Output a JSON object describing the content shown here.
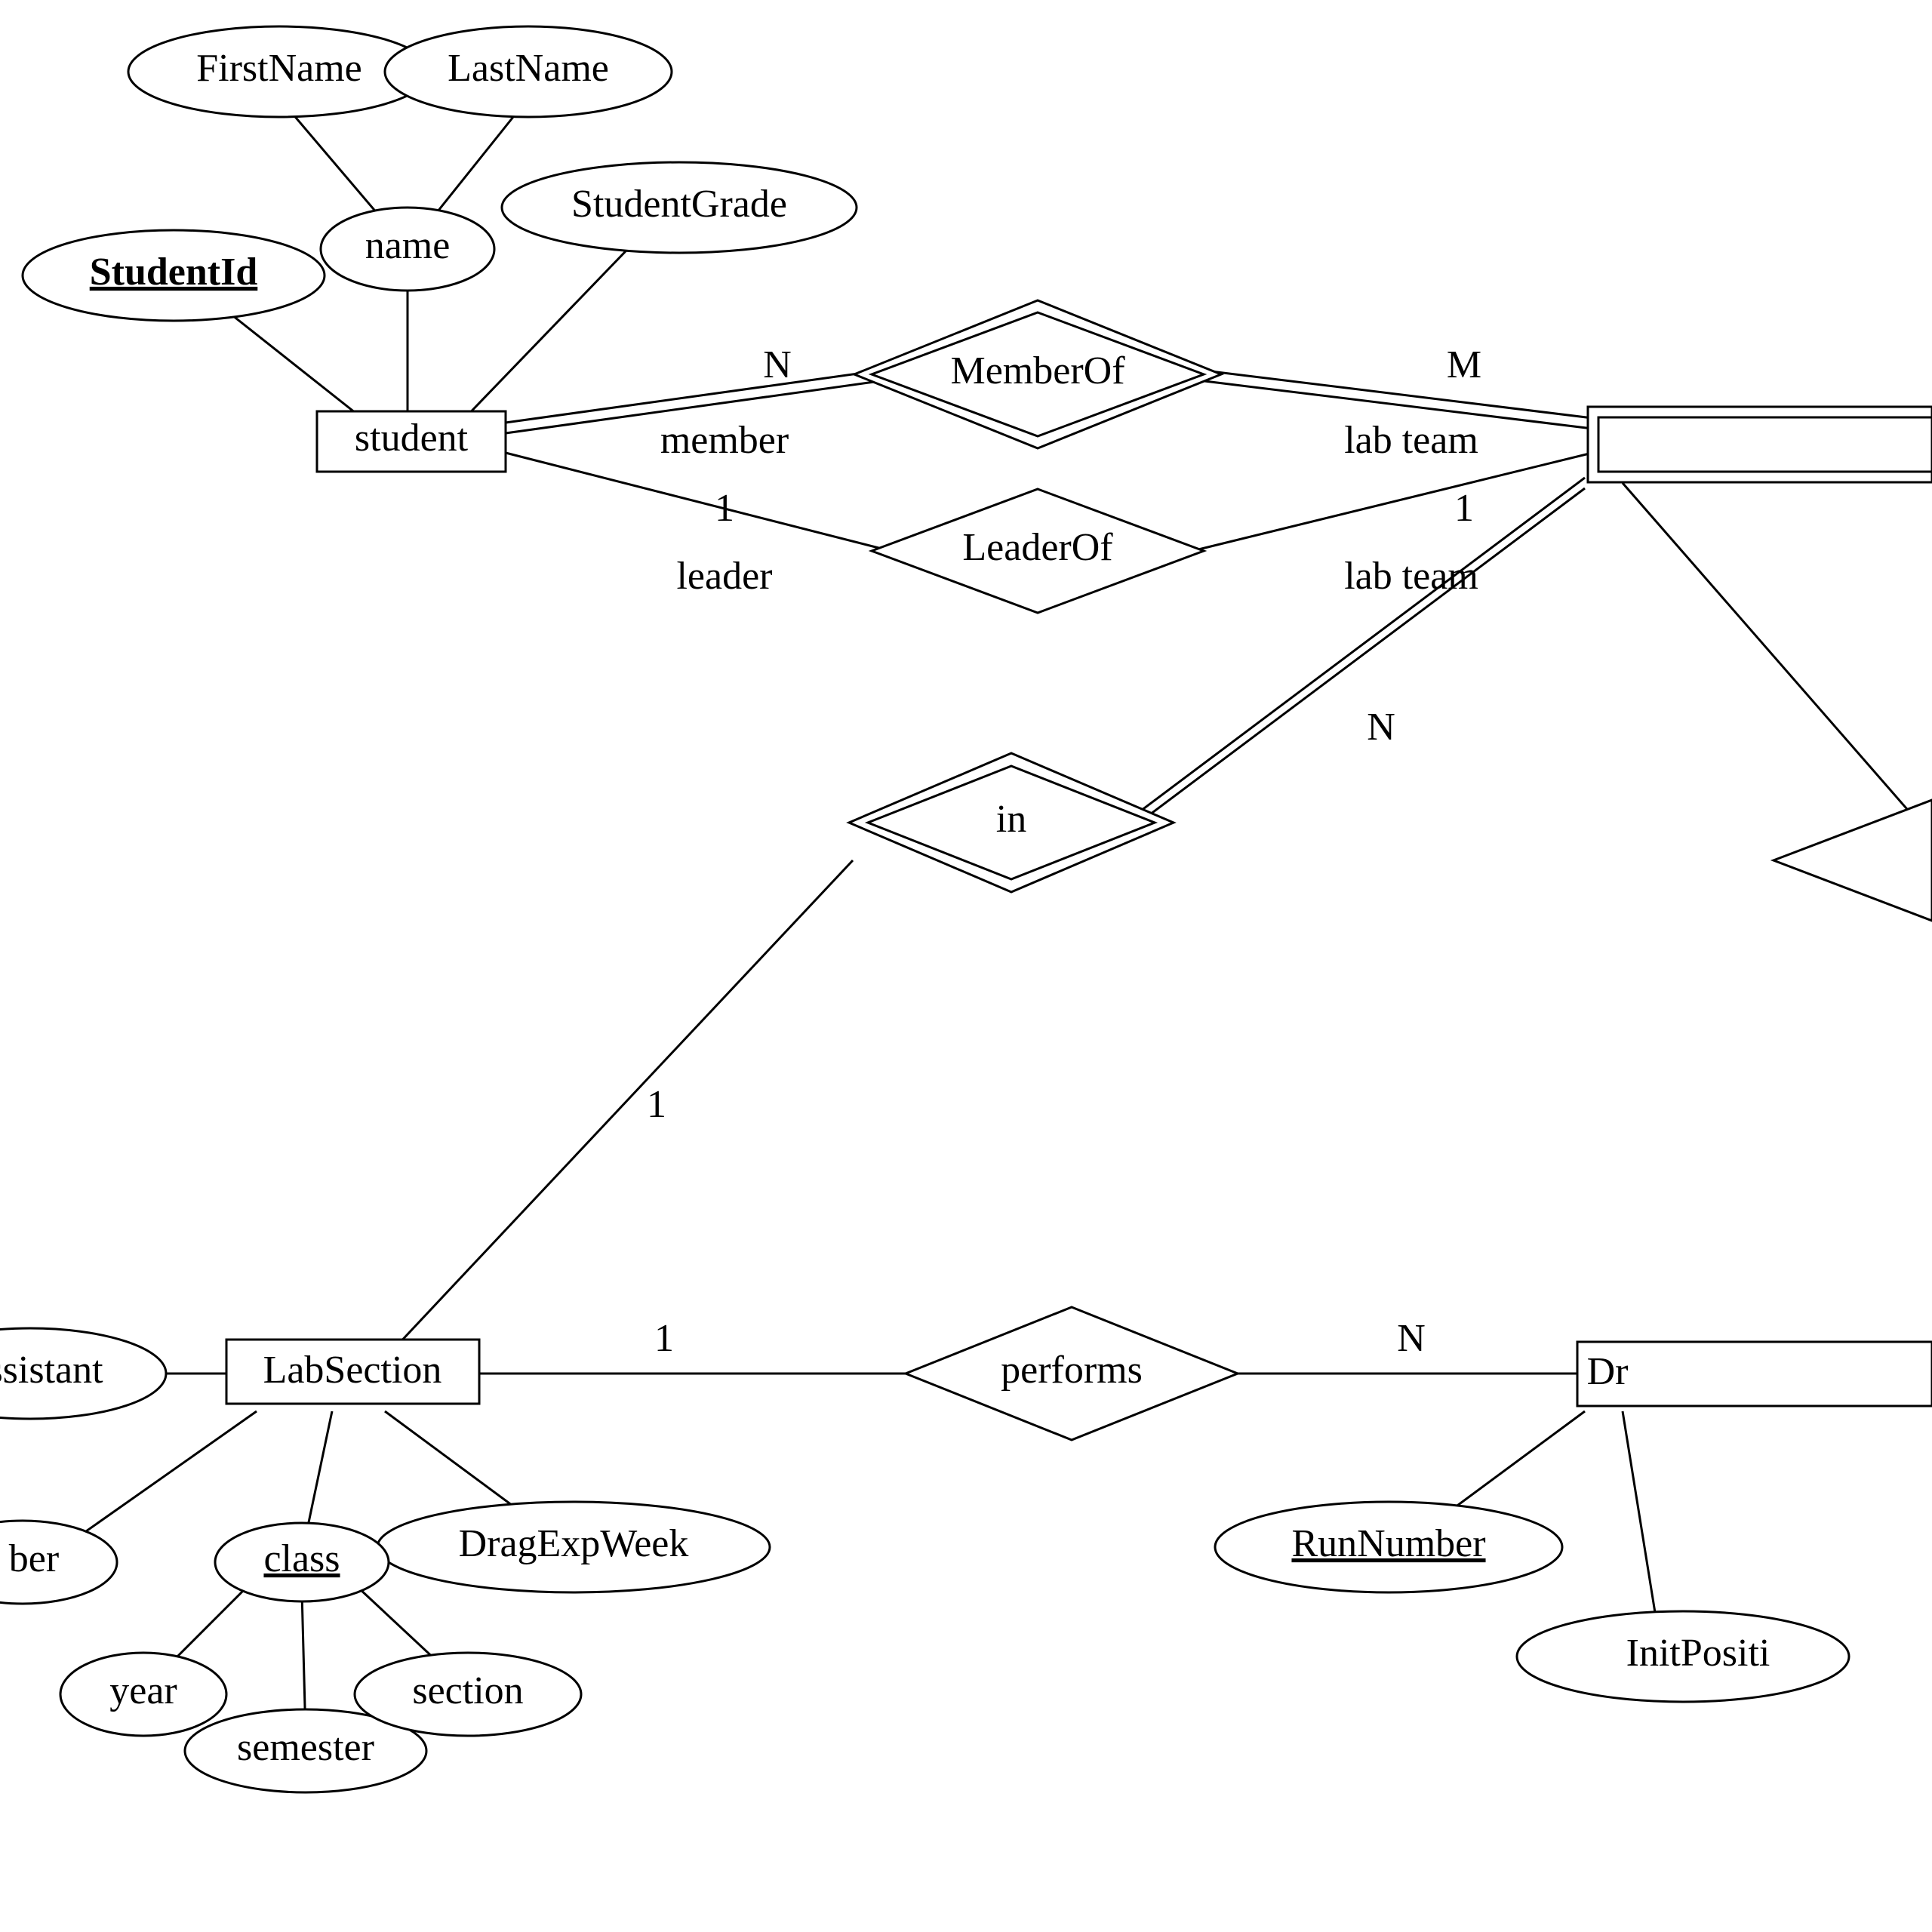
{
  "diagram": {
    "type": "ER",
    "entities": {
      "student": "student",
      "labSection": "LabSection",
      "dragExpRun": "Dr"
    },
    "attributes": {
      "firstName": "FirstName",
      "lastName": "LastName",
      "name": "name",
      "studentId": "StudentId",
      "studentGrade": "StudentGrade",
      "assistant": "ssistant",
      "dragExpWeek": "DragExpWeek",
      "class": "class",
      "year": "year",
      "semester": "semester",
      "section": "section",
      "ber": "ber",
      "runNumber": "RunNumber",
      "initPosition": "InitPositi"
    },
    "relationships": {
      "memberOf": "MemberOf",
      "leaderOf": "LeaderOf",
      "in": "in",
      "performs": "performs"
    },
    "roles": {
      "member": "member",
      "leader": "leader",
      "labteam1": "lab team",
      "labteam2": "lab team"
    },
    "cardinalities": {
      "n1": "N",
      "m1": "M",
      "one1": "1",
      "one2": "1",
      "one3": "1",
      "one4": "1",
      "n2": "N",
      "n3": "N"
    }
  }
}
